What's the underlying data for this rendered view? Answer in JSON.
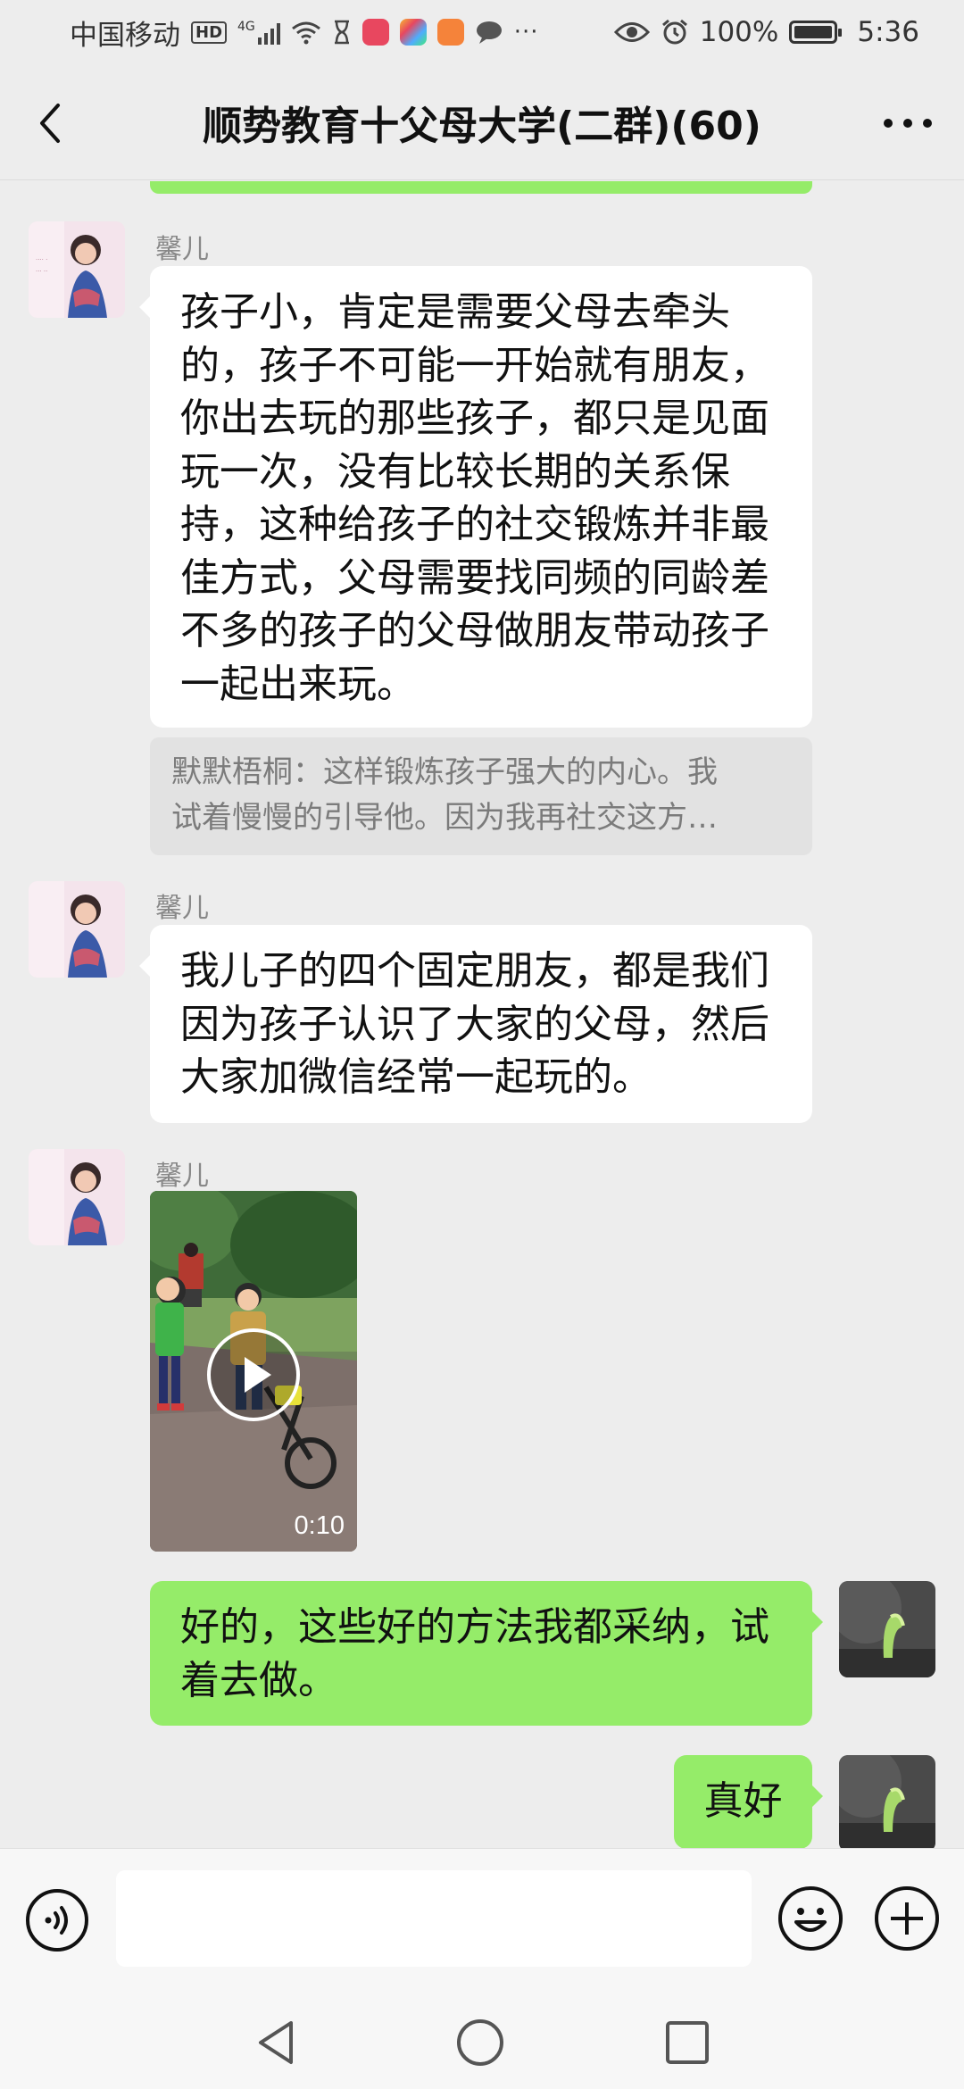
{
  "status_bar": {
    "carrier": "中国移动",
    "hd": "HD",
    "network": "4G",
    "battery": "100%",
    "time": "5:36"
  },
  "header": {
    "title": "顺势教育十父母大学(二群)(60)"
  },
  "messages": [
    {
      "sender": "馨儿",
      "text": "孩子小，肯定是需要父母去牵头的，孩子不可能一开始就有朋友，你出去玩的那些孩子，都只是见面玩一次，没有比较长期的关系保持，这种给孩子的社交锻炼并非最佳方式，父母需要找同频的同龄差不多的孩子的父母做朋友带动孩子一起出来玩。",
      "quote_line1": "默默梧桐：这样锻炼孩子强大的内心。我",
      "quote_line2": "试着慢慢的引导他。因为我再社交这方…"
    },
    {
      "sender": "馨儿",
      "text": "我儿子的四个固定朋友，都是我们因为孩子认识了大家的父母，然后大家加微信经常一起玩的。"
    },
    {
      "sender": "馨儿",
      "video_duration": "0:10"
    },
    {
      "text": "好的，这些好的方法我都采纳，试着去做。"
    },
    {
      "text": "真好"
    }
  ],
  "input": {
    "placeholder": ""
  },
  "colors": {
    "background": "#ededed",
    "self_bubble": "#95ec69",
    "other_bubble": "#ffffff",
    "quote_bg": "#e2e2e2"
  },
  "icons": [
    "back-arrow-icon",
    "more-icon",
    "voice-icon",
    "emoji-icon",
    "plus-icon",
    "nav-back-icon",
    "nav-home-icon",
    "nav-recent-icon",
    "play-icon"
  ]
}
